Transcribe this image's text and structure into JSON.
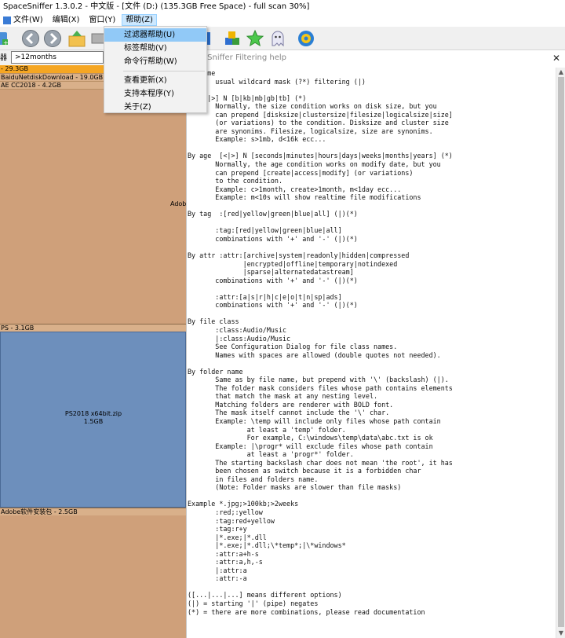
{
  "window": {
    "title": "SpaceSniffer 1.3.0.2  -  中文版  -  [文件 (D:) (135.3GB Free Space) - full scan 30%]"
  },
  "menubar": {
    "items": [
      {
        "label": "文件(W)"
      },
      {
        "label": "编辑(X)"
      },
      {
        "label": "窗口(Y)"
      },
      {
        "label": "帮助(Z)"
      }
    ]
  },
  "help_menu": {
    "items": [
      {
        "label": "过滤器帮助(U)"
      },
      {
        "label": "标签帮助(V)"
      },
      {
        "label": "命令行帮助(W)"
      },
      {
        "label": "查看更新(X)"
      },
      {
        "label": "支持本程序(Y)"
      },
      {
        "label": "关于(Z)"
      }
    ]
  },
  "toolbar": {
    "icons": [
      "refresh-icon",
      "back-icon",
      "forward-icon",
      "home-folder-icon",
      "drive-icon",
      "cubes-icon",
      "star-icon",
      "ghost-icon",
      "settings-gear-icon"
    ]
  },
  "filter": {
    "label": "器",
    "value": ">12months"
  },
  "treemap": {
    "blocks": [
      {
        "label": "- 29.3GB"
      },
      {
        "label": "BaiduNetdiskDownload - 19.0GB"
      },
      {
        "label": "AE CC2018 - 4.2GB"
      },
      {
        "label": "Adob"
      },
      {
        "label": "PS - 3.1GB"
      },
      {
        "label": "PS2018 x64bit.zip"
      },
      {
        "label": "1.5GB"
      },
      {
        "label": "Adobe软件安装包 - 2.5GB"
      }
    ]
  },
  "help": {
    "title": "eSniffer Filtering help",
    "close": "✕",
    "text": "le name\n       usual wildcard mask (?*) filtering (|)\n\nze [<|>] N [b|kb|mb|gb|tb] (*)\n       Normally, the size condition works on disk size, but you\n       can prepend [disksize|clustersize|filesize|logicalsize|size]\n       (or variations) to the condition. Disksize and cluster size\n       are synonims. Filesize, logicalsize, size are synonims.\n       Example: s>1mb, d<16k ecc...\n\nBy age  [<|>] N [seconds|minutes|hours|days|weeks|months|years] (*)\n       Normally, the age condition works on modify date, but you\n       can prepend [create|access|modify] (or variations)\n       to the condition.\n       Example: c>1month, create>1month, m<1day ecc...\n       Example: m<10s will show realtime file modifications\n\nBy tag  :[red|yellow|green|blue|all] (|)(*)\n\n       :tag:[red|yellow|green|blue|all]\n       combinations with '+' and '-' (|)(*)\n\nBy attr :attr:[archive|system|readonly|hidden|compressed\n              |encrypted|offline|temporary|notindexed\n              |sparse|alternatedatastream]\n       combinations with '+' and '-' (|)(*)\n\n       :attr:[a|s|r|h|c|e|o|t|n|sp|ads]\n       combinations with '+' and '-' (|)(*)\n\nBy file class\n       :class:Audio/Music\n       |:class:Audio/Music\n       See Configuration Dialog for file class names.\n       Names with spaces are allowed (double quotes not needed).\n\nBy folder name\n       Same as by file name, but prepend with '\\' (backslash) (|).\n       The folder mask considers files whose path contains elements\n       that match the mask at any nesting level.\n       Matching folders are renderer with BOLD font.\n       The mask itself cannot include the '\\' char.\n       Example: \\temp will include only files whose path contain\n               at least a 'temp' folder.\n               For example, C:\\windows\\temp\\data\\abc.txt is ok\n       Example: |\\progr* will exclude files whose path contain\n               at least a 'progr*' folder.\n       The starting backslash char does not mean 'the root', it has\n       been chosen as switch because it is a forbidden char\n       in files and folders name.\n       (Note: Folder masks are slower than file masks)\n\nExample *.jpg;>100kb;>2weeks\n       :red;:yellow\n       :tag:red+yellow\n       :tag:r+y\n       |*.exe;|*.dll\n       |*.exe;|*.dll;\\*temp*;|\\*windows*\n       :attr:a+h-s\n       :attr:a,h,-s\n       |:attr:a\n       :attr:-a\n\n([...|...|...] means different options)\n(|) = starting '|' (pipe) negates\n(*) = there are more combinations, please read documentation"
  },
  "colors": {
    "treemap_tan": "#d4a67d",
    "treemap_blue": "#6d8fbc",
    "header_orange": "#f5a623",
    "menu_highlight": "#91c9f7"
  }
}
